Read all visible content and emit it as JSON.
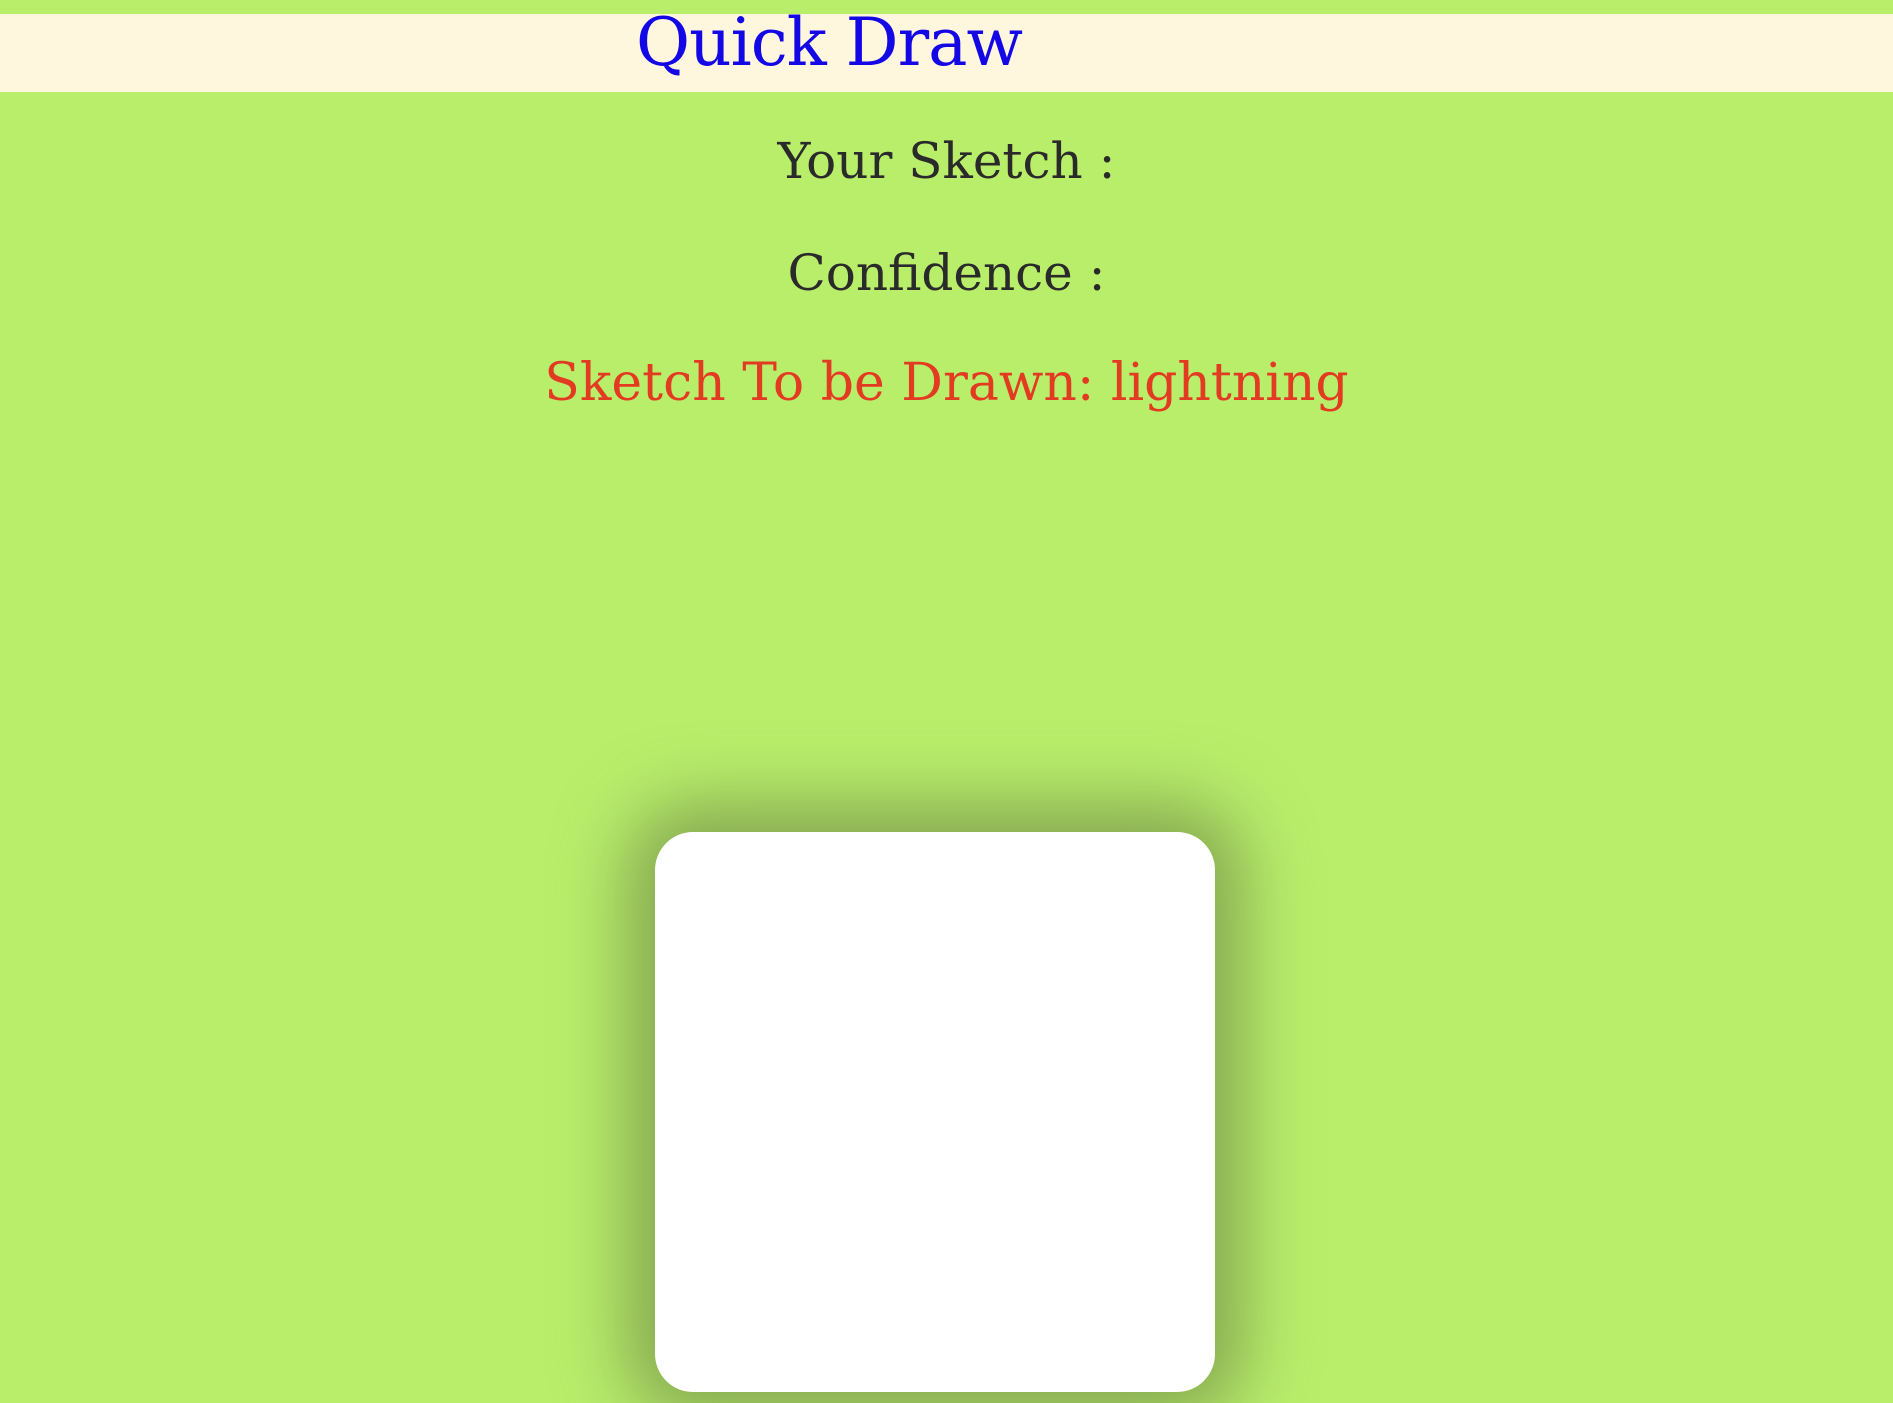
{
  "header": {
    "title": "Quick Draw"
  },
  "status": {
    "your_sketch_label": "Your Sketch :",
    "confidence_label": "Confidence :",
    "target_label": "Sketch To be Drawn: lightning"
  },
  "colors": {
    "page_background": "#b9ee6b",
    "header_background": "#fff7dd",
    "title_color": "#1407e6",
    "text_color": "#2a2a2a",
    "target_color": "#e33a22",
    "canvas_background": "#ffffff"
  }
}
